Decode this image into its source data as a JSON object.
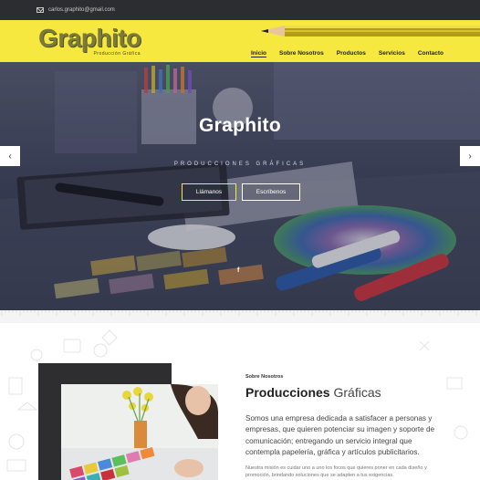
{
  "topbar": {
    "email": "carlos.graphito@gmail.com",
    "mail_icon": "mail-icon"
  },
  "brand": {
    "name": "Graphito",
    "tagline": "Producción Gráfica",
    "accent": "#f6e83f"
  },
  "nav": {
    "items": [
      "Inicio",
      "Sobre Nosotros",
      "Productos",
      "Servicios",
      "Contacto"
    ],
    "active": "Inicio"
  },
  "hero": {
    "title": "Graphito",
    "subtitle": "PRODUCCIONES GRÁFICAS",
    "call_label": "Llámanos",
    "write_label": "Escríbenos",
    "social_icon": "f",
    "prev_arrow": "‹",
    "next_arrow": "›"
  },
  "about": {
    "kicker": "Sobre Nosotros",
    "title_bold": "Producciones",
    "title_light": "Gráficas",
    "text": "Somos una empresa dedicada a satisfacer a personas y empresas, que quieren potenciar su imagen y soporte de comunicación; entregando un servicio integral que contempla papelería, gráfica y artículos publicitarios.",
    "text2": "Nuestra misión es cuidar uno a uno los focos que quieres poner en cada diseño y promoción, brindando soluciones que se adapten a tus exigencias."
  }
}
